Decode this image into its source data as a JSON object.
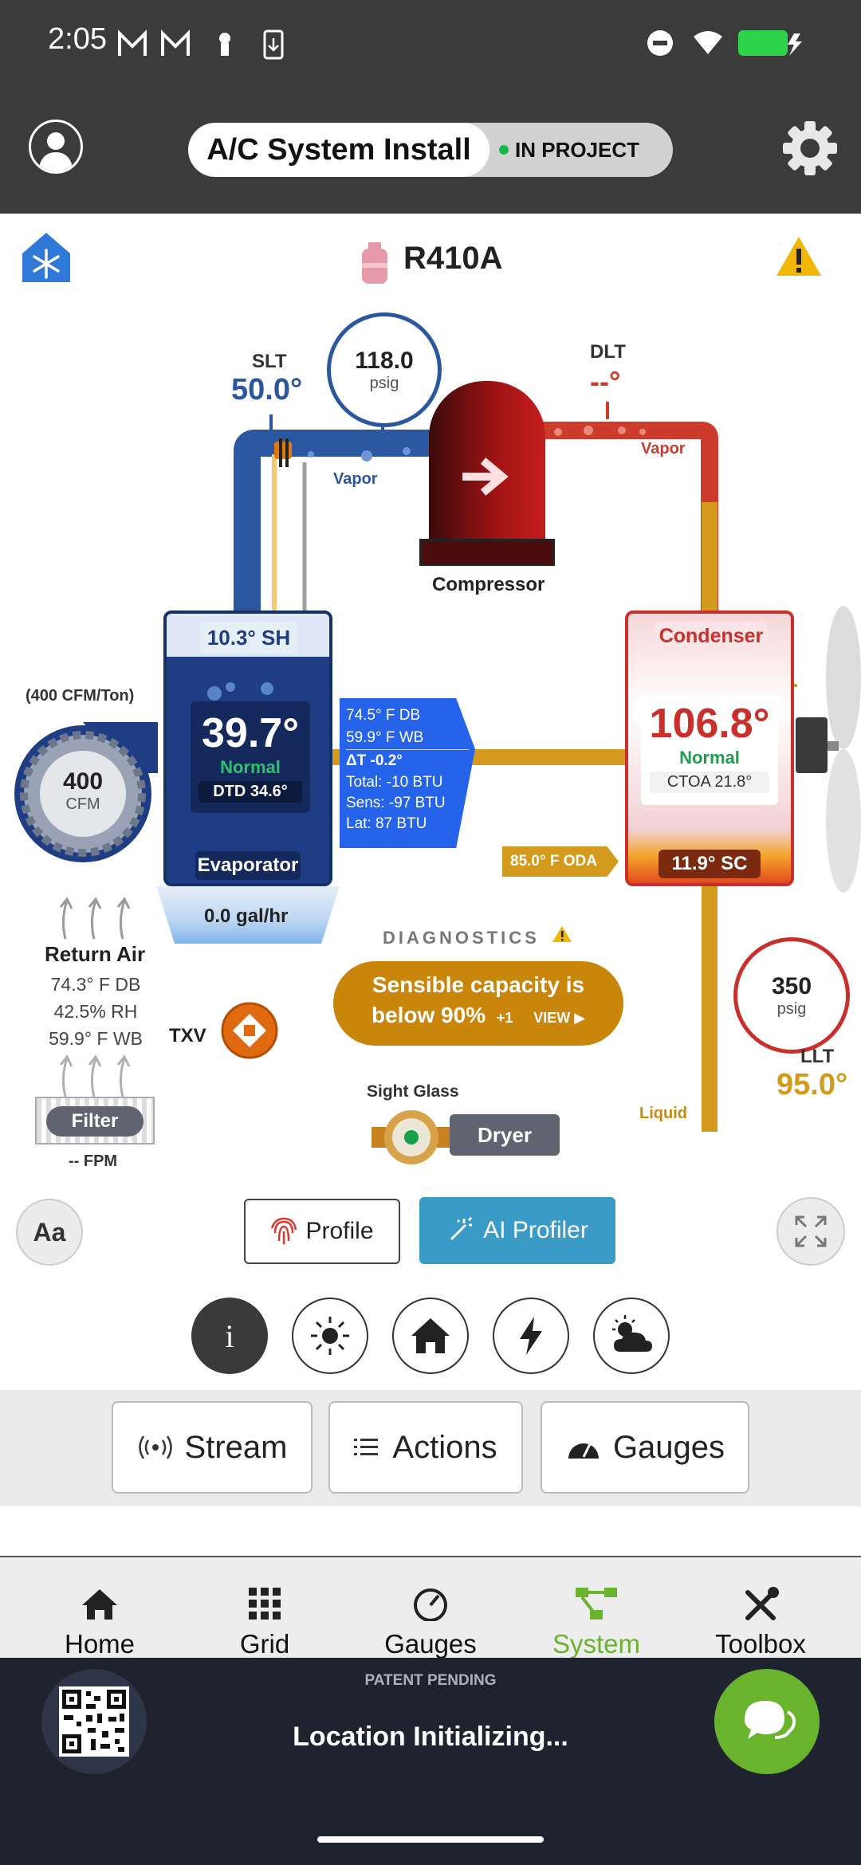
{
  "status_bar": {
    "time": "2:05"
  },
  "header": {
    "project_name": "A/C System Install",
    "project_status": "IN PROJECT"
  },
  "system": {
    "refrigerant": "R410A",
    "slt": {
      "label": "SLT",
      "value": "50.0°"
    },
    "suction_pressure": {
      "value": "118.0",
      "unit": "psig"
    },
    "dlt": {
      "label": "DLT",
      "value": "--°"
    },
    "vapor_left": "Vapor",
    "vapor_right": "Vapor",
    "compressor_label": "Compressor",
    "liquid_label": "Liquid",
    "evaporator": {
      "superheat": "10.3° SH",
      "temp": "39.7°",
      "status": "Normal",
      "dtd": "DTD 34.6°",
      "label": "Evaporator",
      "condensate": "0.0 gal/hr"
    },
    "condenser": {
      "label": "Condenser",
      "temp": "106.8°",
      "status": "Normal",
      "ctoa": "CTOA 21.8°",
      "subcool": "11.9° SC"
    },
    "oda": "85.0° F ODA",
    "air_card": {
      "db": "74.5° F DB",
      "wb": "59.9° F WB",
      "delta_t": "ΔT -0.2°",
      "total": "Total: -10 BTU",
      "sens": "Sens: -97 BTU",
      "lat": "Lat: 87 BTU"
    },
    "blower": {
      "rating": "(400 CFM/Ton)",
      "cfm_value": "400",
      "cfm_unit": "CFM"
    },
    "return_air": {
      "title": "Return Air",
      "db": "74.3° F DB",
      "rh": "42.5% RH",
      "wb": "59.9° F WB"
    },
    "filter": {
      "label": "Filter",
      "fpm": "-- FPM"
    },
    "txv_label": "TXV",
    "liquid_pressure": {
      "value": "350",
      "unit": "psig"
    },
    "llt": {
      "label": "LLT",
      "value": "95.0°"
    },
    "sight_glass_label": "Sight Glass",
    "dryer_label": "Dryer",
    "diagnostics": {
      "title": "DIAGNOSTICS",
      "message_line1": "Sensible capacity is",
      "message_line2": "below 90%",
      "extra": "+1",
      "view": "VIEW ▶"
    }
  },
  "controls": {
    "font_button": "Aa",
    "profile": "Profile",
    "ai_profiler": "AI Profiler"
  },
  "segments": {
    "stream": "Stream",
    "actions": "Actions",
    "gauges": "Gauges"
  },
  "nav": {
    "items": [
      "Home",
      "Grid",
      "Gauges",
      "System",
      "Toolbox"
    ],
    "active": "System"
  },
  "footer": {
    "patent": "PATENT PENDING",
    "location": "Location Initializing..."
  },
  "colors": {
    "suction": "#2b56a0",
    "discharge": "#cc3b2b",
    "liquid": "#d39a1d",
    "accent_green": "#6ab42d"
  }
}
